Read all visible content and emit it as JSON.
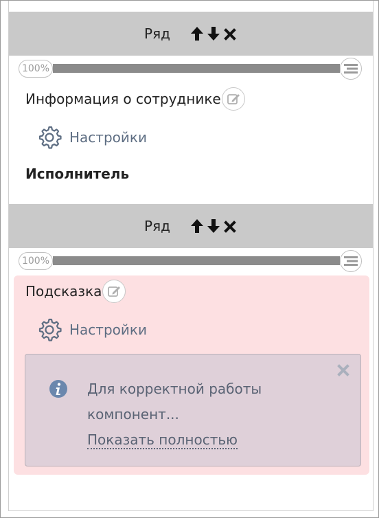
{
  "rows": [
    {
      "title": "Ряд",
      "width_label": "100%",
      "field": {
        "label": "Информация о сотруднике",
        "settings_label": "Настройки",
        "value": "Исполнитель"
      }
    },
    {
      "title": "Ряд",
      "width_label": "100%",
      "field": {
        "label": "Подсказка",
        "settings_label": "Настройки",
        "alert_text": "Для корректной работы компонент...",
        "alert_link": "Показать полностью"
      }
    }
  ],
  "icons": {
    "move_up": "arrow-up-icon",
    "move_down": "arrow-down-icon",
    "delete": "close-icon",
    "width_handle": "list-icon",
    "edit": "edit-icon",
    "settings": "gear-icon",
    "info": "info-icon",
    "alert_close": "close-icon"
  },
  "colors": {
    "row_header_bg": "#c9c9c9",
    "hint_panel_bg": "#fde0e2",
    "alert_bg": "#dfd0d9",
    "link_color": "#5d6d82",
    "info_icon": "#6b87ad"
  }
}
